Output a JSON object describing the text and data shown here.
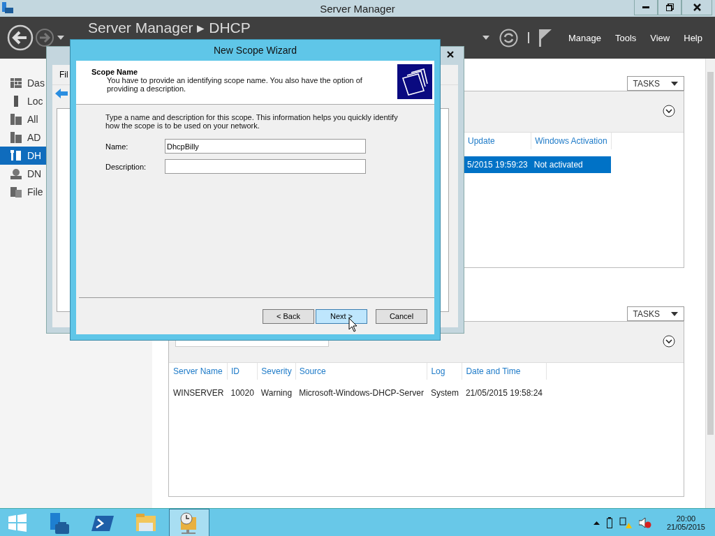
{
  "window": {
    "title": "Server Manager"
  },
  "header": {
    "breadcrumb": "Server Manager ▸ DHCP",
    "menu": [
      "Manage",
      "Tools",
      "View",
      "Help"
    ]
  },
  "sidebar": {
    "items": [
      {
        "label": "Das",
        "kind": "grid",
        "selected": false
      },
      {
        "label": "Loc",
        "kind": "server",
        "selected": false
      },
      {
        "label": "All",
        "kind": "servers",
        "selected": false
      },
      {
        "label": "AD",
        "kind": "servers",
        "selected": false
      },
      {
        "label": "DH",
        "kind": "tools",
        "selected": true
      },
      {
        "label": "DN",
        "kind": "globe",
        "selected": false
      },
      {
        "label": "File",
        "kind": "files",
        "selected": false
      }
    ]
  },
  "tiles": [
    {
      "tasks": "TASKS",
      "columns": [
        "Update",
        "Windows Activation"
      ],
      "rows": [
        {
          "cells": [
            "5/2015 19:59:23",
            "Not activated"
          ],
          "selected": true
        }
      ]
    },
    {
      "tasks": "TASKS",
      "columns": [
        "Server Name",
        "ID",
        "Severity",
        "Source",
        "Log",
        "Date and Time"
      ],
      "rows": [
        {
          "cells": [
            "WINSERVER",
            "10020",
            "Warning",
            "Microsoft-Windows-DHCP-Server",
            "System",
            "21/05/2015 19:58:24"
          ],
          "selected": false
        }
      ]
    }
  ],
  "mmc": {
    "menu": [
      "Fil"
    ]
  },
  "wizard": {
    "title": "New Scope Wizard",
    "heading": "Scope Name",
    "subtitle": "You have to provide an identifying scope name. You also have the option of providing a description.",
    "instructions": "Type a name and description for this scope. This information helps you quickly identify how the scope is to be used on your network.",
    "fields": [
      {
        "label": "Name:",
        "value": "DhcpBilly"
      },
      {
        "label": "Description:"
      }
    ],
    "buttons": [
      {
        "label": "< Back",
        "selected": false
      },
      {
        "label": "Next >",
        "selected": true
      },
      {
        "label": "Cancel",
        "selected": false
      }
    ]
  },
  "taskbar": {
    "apps": [
      {
        "kind": "server-manager",
        "selected": false
      },
      {
        "kind": "powershell",
        "selected": false
      },
      {
        "kind": "explorer",
        "selected": false
      },
      {
        "kind": "dhcp",
        "selected": true
      }
    ],
    "time": "20:00",
    "date": "21/05/2015"
  }
}
